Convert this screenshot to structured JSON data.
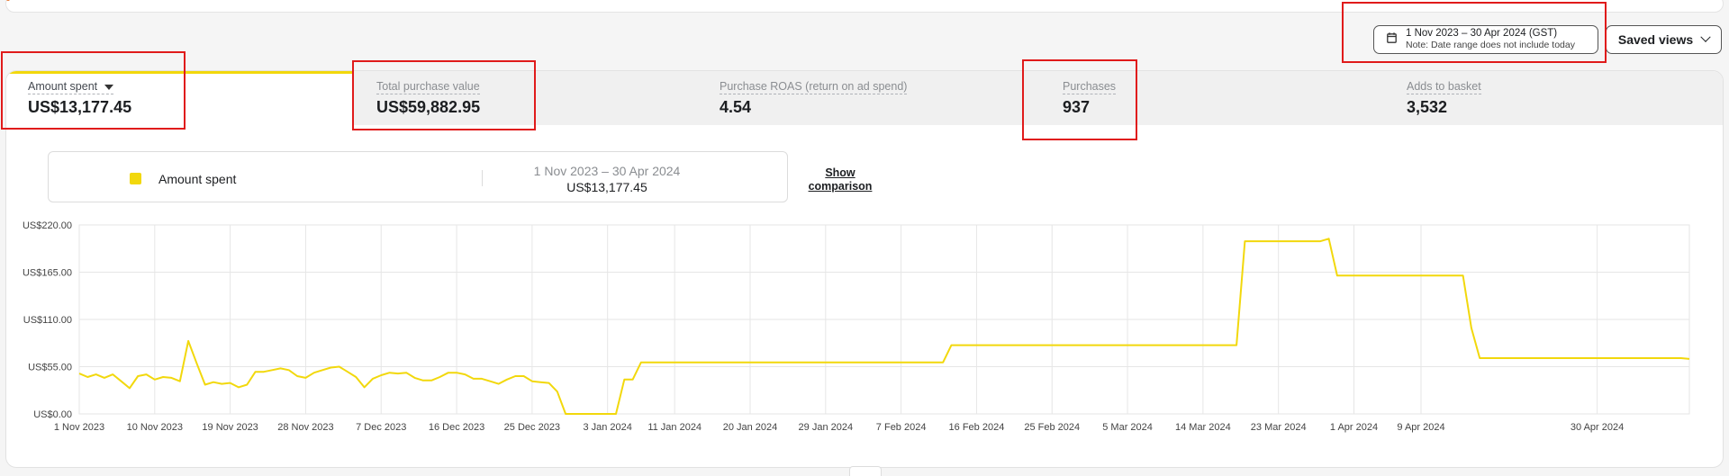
{
  "date_range": {
    "label": "1 Nov 2023 – 30 Apr 2024 (GST)",
    "note": "Note: Date range does not include today",
    "icon": "calendar-icon"
  },
  "saved_views": {
    "label": "Saved views",
    "icon": "chevron-down-icon"
  },
  "metrics": [
    {
      "label": "Amount spent",
      "value": "US$13,177.45",
      "active": true
    },
    {
      "label": "Total purchase value",
      "value": "US$59,882.95"
    },
    {
      "label": "Purchase ROAS (return on ad spend)",
      "value": "4.54"
    },
    {
      "label": "Purchases",
      "value": "937"
    },
    {
      "label": "Adds to basket",
      "value": "3,532"
    }
  ],
  "legend": {
    "series_name": "Amount spent",
    "range": "1 Nov 2023 – 30 Apr 2024",
    "total": "US$13,177.45",
    "show_comparison": "Show comparison"
  },
  "colors": {
    "series": "#f2d80c",
    "highlight": "#e01b1b",
    "accent": "#e8772e"
  },
  "chart_data": {
    "type": "line",
    "title": "",
    "xlabel": "",
    "ylabel": "",
    "ylim": [
      0,
      220
    ],
    "yticks": [
      "US$0.00",
      "US$55.00",
      "US$110.00",
      "US$165.00",
      "US$220.00"
    ],
    "xticks": [
      "1 Nov 2023",
      "10 Nov 2023",
      "19 Nov 2023",
      "28 Nov 2023",
      "7 Dec 2023",
      "16 Dec 2023",
      "25 Dec 2023",
      "3 Jan 2024",
      "11 Jan 2024",
      "20 Jan 2024",
      "29 Jan 2024",
      "7 Feb 2024",
      "16 Feb 2024",
      "25 Feb 2024",
      "5 Mar 2024",
      "14 Mar 2024",
      "23 Mar 2024",
      "1 Apr 2024",
      "9 Apr 2024",
      "30 Apr 2024"
    ],
    "grid": true,
    "series": [
      {
        "name": "Amount spent",
        "values": [
          47,
          43,
          46,
          42,
          46,
          38,
          30,
          44,
          46,
          40,
          43,
          42,
          38,
          85,
          59,
          34,
          37,
          35,
          36,
          31,
          34,
          49,
          49,
          51,
          53,
          51,
          44,
          42,
          48,
          51,
          54,
          55,
          49,
          43,
          31,
          41,
          45,
          48,
          47,
          48,
          42,
          39,
          39,
          43,
          48,
          48,
          46,
          41,
          41,
          38,
          35,
          40,
          44,
          44,
          38,
          37,
          36,
          26,
          0,
          0,
          0,
          0,
          0,
          0,
          0,
          40,
          40,
          60,
          60,
          60,
          60,
          60,
          60,
          60,
          60,
          60,
          60,
          60,
          60,
          60,
          60,
          60,
          60,
          60,
          60,
          60,
          60,
          60,
          60,
          60,
          60,
          60,
          60,
          60,
          60,
          60,
          60,
          60,
          60,
          60,
          60,
          60,
          60,
          60,
          80,
          80,
          80,
          80,
          80,
          80,
          80,
          80,
          80,
          80,
          80,
          80,
          80,
          80,
          80,
          80,
          80,
          80,
          80,
          80,
          80,
          80,
          80,
          80,
          80,
          80,
          80,
          80,
          80,
          80,
          80,
          80,
          80,
          80,
          80,
          201,
          201,
          201,
          201,
          201,
          201,
          201,
          201,
          201,
          201,
          204,
          161,
          161,
          161,
          161,
          161,
          161,
          161,
          161,
          161,
          161,
          161,
          161,
          161,
          161,
          161,
          161,
          100,
          65,
          65,
          65,
          65,
          65,
          65,
          65,
          65,
          65,
          65,
          65,
          65,
          65,
          65,
          65,
          65,
          65,
          65,
          65,
          65,
          65,
          65,
          65,
          65,
          65,
          64
        ]
      }
    ]
  }
}
